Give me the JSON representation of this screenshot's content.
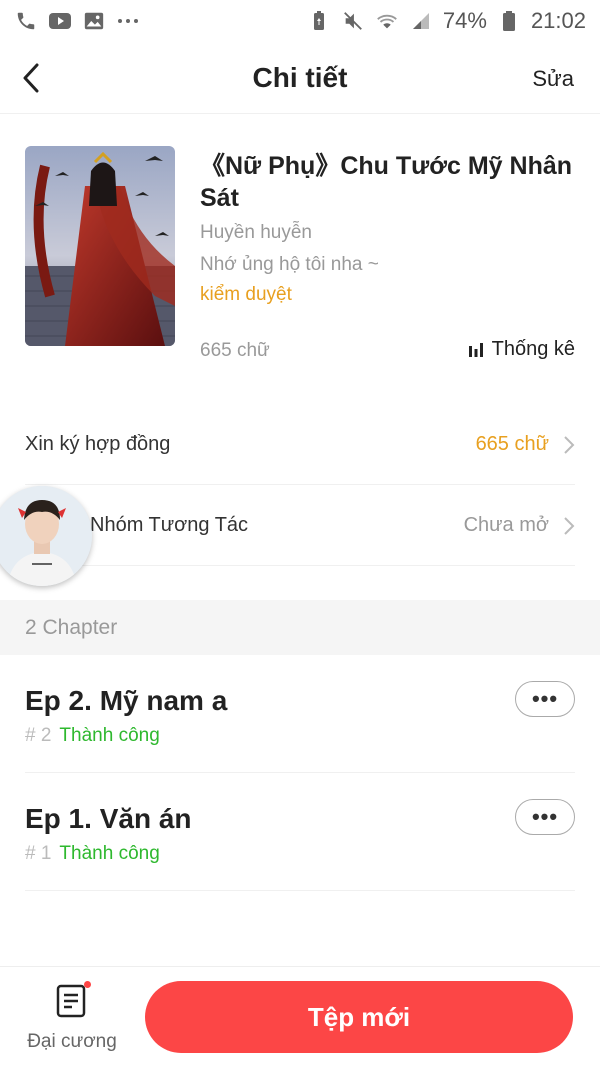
{
  "status_bar": {
    "battery": "74%",
    "time": "21:02",
    "icons": [
      "phone-icon",
      "youtube-icon",
      "image-icon",
      "more-dots-icon",
      "battery-saver-icon",
      "mute-icon",
      "wifi-icon",
      "signal-icon",
      "battery-icon"
    ]
  },
  "header": {
    "title": "Chi tiết",
    "edit_label": "Sửa"
  },
  "book": {
    "title": "《Nữ Phụ》Chu Tước Mỹ Nhân Sát",
    "genre": "Huyền huyễn",
    "description": "Nhớ ủng hộ tôi nha ~",
    "review_status": "kiểm duyệt",
    "word_count": "665 chữ",
    "stats_label": "Thống kê"
  },
  "rows": {
    "contract": {
      "label": "Xin ký hợp đồng",
      "value": "665 chữ"
    },
    "group": {
      "label": "Nhóm Tương Tác",
      "value": "Chưa mở"
    }
  },
  "chapter_section": {
    "header": "2 Chapter",
    "chapters": [
      {
        "title": "Ep 2. Mỹ nam a",
        "number": "# 2",
        "status": "Thành công",
        "more": "•••"
      },
      {
        "title": "Ep 1. Văn án",
        "number": "# 1",
        "status": "Thành công",
        "more": "•••"
      }
    ]
  },
  "bottom_bar": {
    "outline_label": "Đại cương",
    "new_file_label": "Tệp mới"
  },
  "colors": {
    "accent_red": "#fc4646",
    "orange": "#e8a020",
    "success_green": "#2eb82e",
    "muted_grey": "#999999"
  }
}
